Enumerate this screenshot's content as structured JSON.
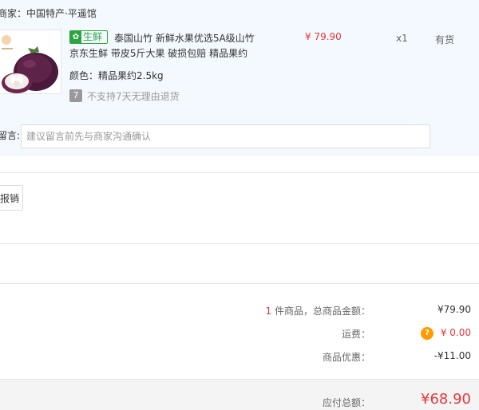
{
  "seller": {
    "label": "商家：",
    "name": "中国特产·平遥馆"
  },
  "product": {
    "tag": "生鲜",
    "tag_icon": "fresh-leaf-icon",
    "title_line1": "泰国山竹 新鲜水果优选5A级山竹",
    "title_line2": "京东生鲜 带皮5斤大果 破损包赔 精品果约",
    "color_label": "颜色：",
    "color_value": "精品果约2.5kg",
    "return_policy": "不支持7天无理由退货",
    "price": "¥ 79.90",
    "quantity": "x1",
    "stock": "有货"
  },
  "note": {
    "label": "留言:",
    "placeholder": "建议留言前先与商家沟通确认"
  },
  "invoice": {
    "button_label": "报销"
  },
  "summary": {
    "item_count": "1",
    "items_label": " 件商品，总商品金额：",
    "items_total": "¥79.90",
    "shipping_label": "运费：",
    "shipping_value": "¥ 0.00",
    "discount_label": "商品优惠：",
    "discount_value": "-¥11.00",
    "payable_label": "应付总额：",
    "payable_value": "¥68.90"
  },
  "colors": {
    "accent_red": "#e4393c",
    "fresh_green": "#2aa63f",
    "help_orange": "#ff9b00",
    "panel_bg": "#f3f9fe"
  }
}
